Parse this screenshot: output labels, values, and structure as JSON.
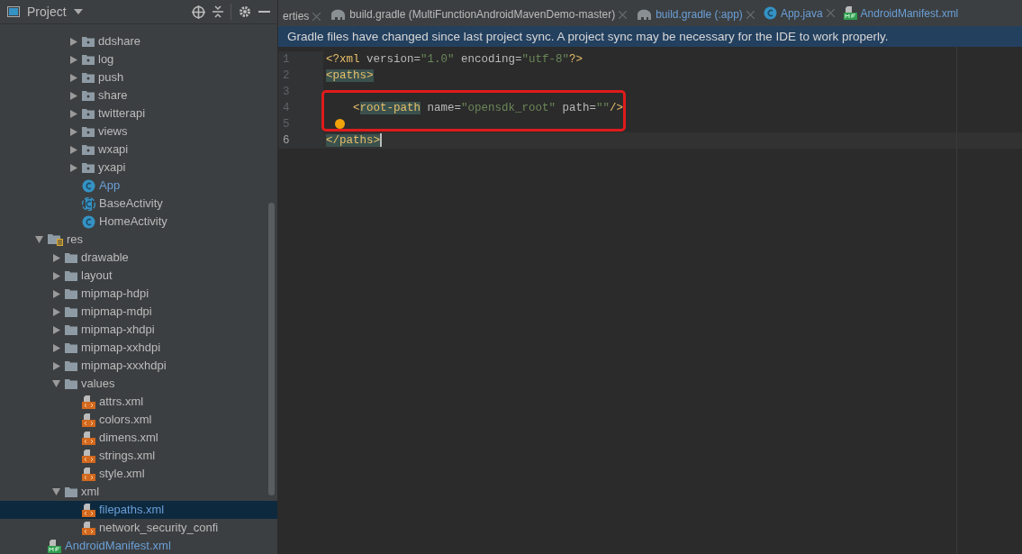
{
  "project_panel": {
    "title": "Project",
    "tree": [
      {
        "children": [
          {
            "children": [
              {
                "label": "ddshare",
                "kind": "package",
                "expanded": false,
                "modified": false,
                "selected": false
              },
              {
                "label": "log",
                "kind": "package",
                "expanded": false,
                "modified": false,
                "selected": false
              },
              {
                "label": "push",
                "kind": "package",
                "expanded": false,
                "modified": false,
                "selected": false
              },
              {
                "label": "share",
                "kind": "package",
                "expanded": false,
                "modified": false,
                "selected": false
              },
              {
                "label": "twitterapi",
                "kind": "package",
                "expanded": false,
                "modified": false,
                "selected": false
              },
              {
                "label": "views",
                "kind": "package",
                "expanded": false,
                "modified": false,
                "selected": false
              },
              {
                "label": "wxapi",
                "kind": "package",
                "expanded": false,
                "modified": false,
                "selected": false
              },
              {
                "label": "yxapi",
                "kind": "package",
                "expanded": false,
                "modified": false,
                "selected": false
              },
              {
                "label": "App",
                "kind": "class",
                "modified": true,
                "selected": false
              },
              {
                "label": "BaseActivity",
                "kind": "abstract_class",
                "modified": false,
                "selected": false
              },
              {
                "label": "HomeActivity",
                "kind": "class",
                "modified": false,
                "selected": false
              }
            ]
          }
        ]
      },
      {
        "label": "res",
        "kind": "res_folder",
        "expanded": true,
        "modified": false,
        "selected": false,
        "children": [
          {
            "label": "drawable",
            "kind": "folder",
            "expanded": false,
            "modified": false,
            "selected": false
          },
          {
            "label": "layout",
            "kind": "folder",
            "expanded": false,
            "modified": false,
            "selected": false
          },
          {
            "label": "mipmap-hdpi",
            "kind": "folder",
            "expanded": false,
            "modified": false,
            "selected": false
          },
          {
            "label": "mipmap-mdpi",
            "kind": "folder",
            "expanded": false,
            "modified": false,
            "selected": false
          },
          {
            "label": "mipmap-xhdpi",
            "kind": "folder",
            "expanded": false,
            "modified": false,
            "selected": false
          },
          {
            "label": "mipmap-xxhdpi",
            "kind": "folder",
            "expanded": false,
            "modified": false,
            "selected": false
          },
          {
            "label": "mipmap-xxxhdpi",
            "kind": "folder",
            "expanded": false,
            "modified": false,
            "selected": false
          },
          {
            "label": "values",
            "kind": "folder",
            "expanded": true,
            "modified": false,
            "selected": false,
            "children": [
              {
                "label": "attrs.xml",
                "kind": "xml",
                "modified": false,
                "selected": false
              },
              {
                "label": "colors.xml",
                "kind": "xml",
                "modified": false,
                "selected": false
              },
              {
                "label": "dimens.xml",
                "kind": "xml",
                "modified": false,
                "selected": false
              },
              {
                "label": "strings.xml",
                "kind": "xml",
                "modified": false,
                "selected": false
              },
              {
                "label": "style.xml",
                "kind": "xml",
                "modified": false,
                "selected": false
              }
            ]
          },
          {
            "label": "xml",
            "kind": "folder",
            "expanded": true,
            "modified": false,
            "selected": false,
            "children": [
              {
                "label": "filepaths.xml",
                "kind": "xml",
                "modified": true,
                "selected": true
              },
              {
                "label": "network_security_confi",
                "kind": "xml",
                "modified": false,
                "selected": false
              }
            ]
          }
        ]
      },
      {
        "label": "AndroidManifest.xml",
        "kind": "manifest",
        "modified": true,
        "selected": false
      }
    ]
  },
  "tabs": [
    {
      "label": "erties",
      "kind": "plain",
      "modified": false,
      "closable": true,
      "selected": false
    },
    {
      "label": "build.gradle (MultiFunctionAndroidMavenDemo-master)",
      "kind": "gradle",
      "modified": false,
      "closable": true,
      "selected": false
    },
    {
      "label": "build.gradle (:app)",
      "kind": "gradle",
      "modified": true,
      "closable": true,
      "selected": false
    },
    {
      "label": "App.java",
      "kind": "class",
      "modified": true,
      "closable": true,
      "selected": false
    },
    {
      "label": "AndroidManifest.xml",
      "kind": "manifest",
      "modified": true,
      "closable": false,
      "selected": false
    }
  ],
  "notification": "Gradle files have changed since last project sync. A project sync may be necessary for the IDE to work properly.",
  "editor": {
    "lines": [
      {
        "number": "1",
        "current": false,
        "boxed": false,
        "bulb": false,
        "tokens": [
          {
            "kind": "tag",
            "text": "<?xml"
          },
          {
            "kind": "attr",
            "text": " version="
          },
          {
            "kind": "value",
            "text": "\"1.0\""
          },
          {
            "kind": "attr",
            "text": " encoding="
          },
          {
            "kind": "value",
            "text": "\"utf-8\""
          },
          {
            "kind": "tag",
            "text": "?>"
          }
        ]
      },
      {
        "number": "2",
        "current": false,
        "boxed": false,
        "bulb": false,
        "tokens": [
          {
            "kind": "tag_match",
            "text": "<paths>"
          }
        ]
      },
      {
        "number": "3",
        "current": false,
        "boxed": false,
        "bulb": false
      },
      {
        "number": "4",
        "current": false,
        "boxed": true,
        "bulb": false,
        "tokens": [
          {
            "kind": "tag",
            "text": "    <"
          },
          {
            "kind": "tag_match",
            "text": "root-path"
          },
          {
            "kind": "attr",
            "text": " name="
          },
          {
            "kind": "value",
            "text": "\"opensdk_root\""
          },
          {
            "kind": "attr",
            "text": " path="
          },
          {
            "kind": "value",
            "text": "\"\""
          },
          {
            "kind": "tag",
            "text": "/>"
          }
        ]
      },
      {
        "number": "5",
        "current": false,
        "boxed": true,
        "bulb": true
      },
      {
        "number": "6",
        "current": true,
        "boxed": false,
        "bulb": false,
        "tokens": [
          {
            "kind": "tag_match",
            "text": "</paths>"
          }
        ]
      }
    ]
  }
}
